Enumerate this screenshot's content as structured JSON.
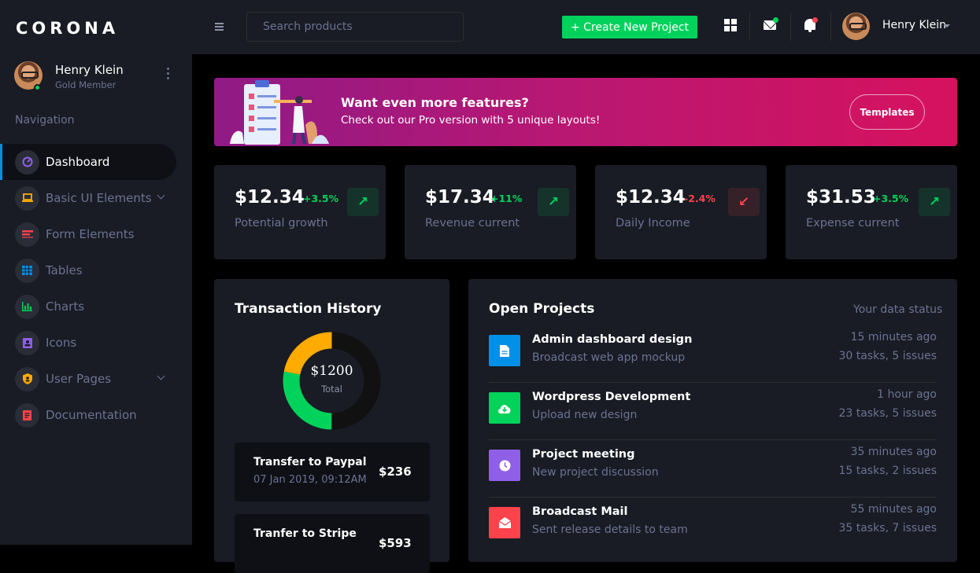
{
  "brand": "CORONA",
  "profile": {
    "name": "Henry Klein",
    "role": "Gold Member"
  },
  "navigation": {
    "title": "Navigation",
    "items": [
      {
        "label": "Dashboard",
        "icon": "speedometer-icon",
        "color": "#8f5fe8",
        "active": true
      },
      {
        "label": "Basic UI Elements",
        "icon": "laptop-icon",
        "color": "#ffab00",
        "expandable": true
      },
      {
        "label": "Form Elements",
        "icon": "form-icon",
        "color": "#fc424a"
      },
      {
        "label": "Tables",
        "icon": "table-icon",
        "color": "#0090e7"
      },
      {
        "label": "Charts",
        "icon": "chart-icon",
        "color": "#00d25b"
      },
      {
        "label": "Icons",
        "icon": "contacts-icon",
        "color": "#8f5fe8"
      },
      {
        "label": "User Pages",
        "icon": "shield-icon",
        "color": "#ffab00",
        "expandable": true
      },
      {
        "label": "Documentation",
        "icon": "document-icon",
        "color": "#fc424a"
      }
    ]
  },
  "topbar": {
    "search_placeholder": "Search products",
    "create_label": "+ Create New Project",
    "user_name": "Henry Klein"
  },
  "banner": {
    "title": "Want even more features?",
    "subtitle": "Check out our Pro version with 5 unique layouts!",
    "button": "Templates"
  },
  "stats": [
    {
      "value": "$12.34",
      "change": "+3.5%",
      "label": "Potential growth",
      "trend": "up"
    },
    {
      "value": "$17.34",
      "change": "+11%",
      "label": "Revenue current",
      "trend": "up"
    },
    {
      "value": "$12.34",
      "change": "-2.4%",
      "label": "Daily Income",
      "trend": "down"
    },
    {
      "value": "$31.53",
      "change": "+3.5%",
      "label": "Expense current",
      "trend": "up"
    }
  ],
  "transactions": {
    "title": "Transaction History",
    "total_amount": "$1200",
    "total_label": "Total",
    "donut_segments": [
      {
        "color": "#111111",
        "fraction": 0.5
      },
      {
        "color": "#00d25b",
        "fraction": 0.28
      },
      {
        "color": "#ffab00",
        "fraction": 0.22
      }
    ],
    "items": [
      {
        "name": "Transfer to Paypal",
        "date": "07 Jan 2019, 09:12AM",
        "amount": "$236"
      },
      {
        "name": "Tranfer to Stripe",
        "date": "",
        "amount": "$593"
      }
    ]
  },
  "projects": {
    "title": "Open Projects",
    "status": "Your data status",
    "items": [
      {
        "title": "Admin dashboard design",
        "subtitle": "Broadcast web app mockup",
        "time": "15 minutes ago",
        "tasks": "30 tasks, 5 issues",
        "icon": "file-icon",
        "color": "#0090e7"
      },
      {
        "title": "Wordpress Development",
        "subtitle": "Upload new design",
        "time": "1 hour ago",
        "tasks": "23 tasks, 5 issues",
        "icon": "cloud-download-icon",
        "color": "#00d25b"
      },
      {
        "title": "Project meeting",
        "subtitle": "New project discussion",
        "time": "35 minutes ago",
        "tasks": "15 tasks, 2 issues",
        "icon": "clock-icon",
        "color": "#8f5fe8"
      },
      {
        "title": "Broadcast Mail",
        "subtitle": "Sent release details to team",
        "time": "55 minutes ago",
        "tasks": "35 tasks, 7 issues",
        "icon": "email-open-icon",
        "color": "#fc424a"
      }
    ]
  }
}
